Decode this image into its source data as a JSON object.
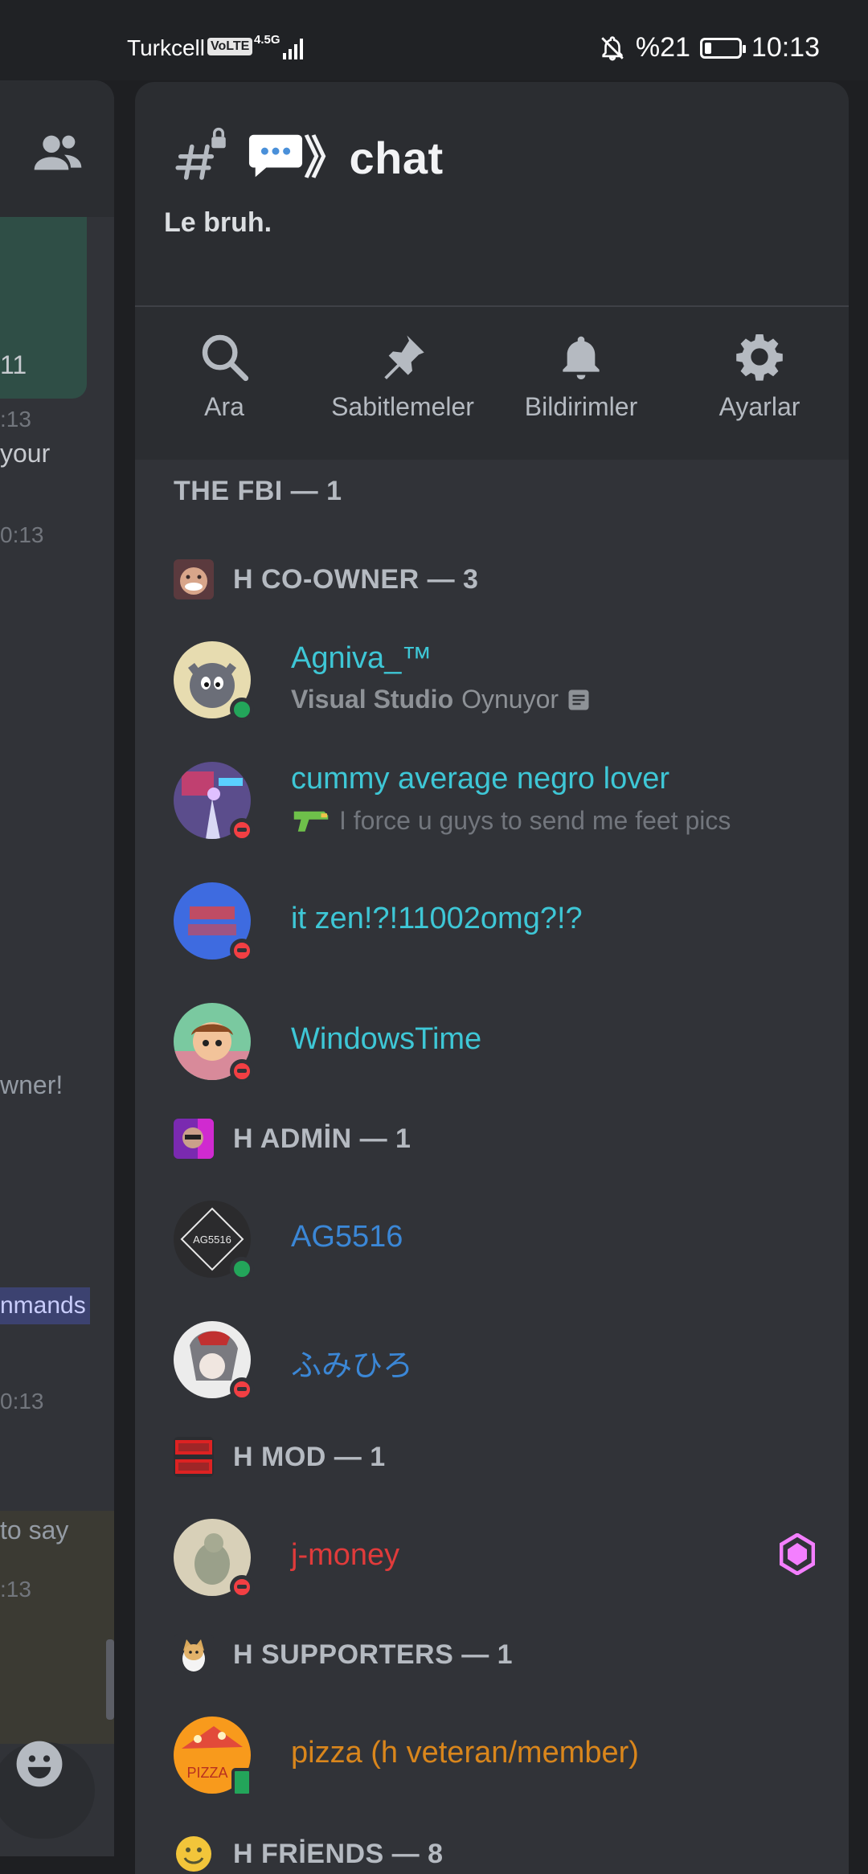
{
  "status_bar": {
    "carrier": "Turkcell",
    "volte": "VoLTE",
    "network": "4.5G",
    "battery_percent": "%21",
    "battery_level": 0.21,
    "time": "10:13"
  },
  "background_chat": {
    "fragments": [
      "11",
      ":13",
      "your",
      "0:13",
      "wner!",
      "nmands",
      "0:13",
      "to say",
      ":13"
    ]
  },
  "channel": {
    "name": "💬》chat",
    "name_text": "》chat",
    "topic": "Le bruh."
  },
  "actions": [
    {
      "label": "Ara",
      "icon": "search-icon"
    },
    {
      "label": "Sabitlemeler",
      "icon": "pin-icon"
    },
    {
      "label": "Bildirimler",
      "icon": "bell-icon"
    },
    {
      "label": "Ayarlar",
      "icon": "gear-icon"
    }
  ],
  "roles": {
    "fbi": "THE FBI — 1",
    "coowner": "H CO-OWNER — 3",
    "admin": "H ADMİN — 1",
    "mod": "H MOD — 1",
    "supporters": "H SUPPORTERS — 1",
    "friends": "H FRİENDS — 8"
  },
  "members": {
    "agniva": {
      "name": "Agniva_™",
      "activity_app": "Visual Studio",
      "activity_verb": "Oynuyor",
      "status": "online"
    },
    "cummy": {
      "name": "cummy average negro lover",
      "custom_status": "I force u guys to send me feet pics",
      "status": "dnd"
    },
    "itzen": {
      "name": "it zen!?!11002omg?!?",
      "status": "dnd"
    },
    "windowstime": {
      "name": "WindowsTime",
      "status": "dnd"
    },
    "ag5516": {
      "name": "AG5516",
      "avatar_text": "AG5516",
      "status": "online"
    },
    "fumihiro": {
      "name": "ふみひろ",
      "status": "dnd"
    },
    "jmoney": {
      "name": "j-money",
      "status": "dnd"
    },
    "pizza": {
      "name": "pizza (h veteran/member)",
      "avatar_text": "PIZZA",
      "status": "mobile"
    }
  },
  "colors": {
    "cyan_role": "#3ec7d6",
    "blue_role": "#3b87d6",
    "red_role": "#e03b3b",
    "orange_role": "#d9861c",
    "boost": "#f47fff"
  }
}
